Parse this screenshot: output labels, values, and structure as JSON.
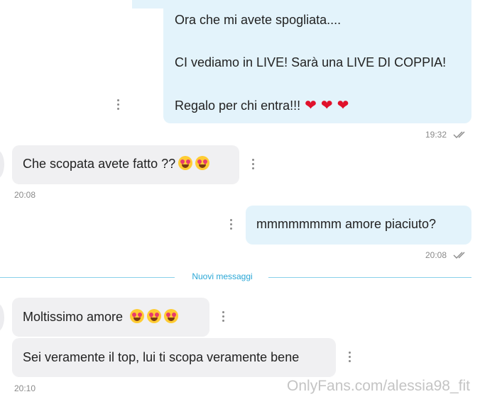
{
  "messages": [
    {
      "lines": [
        "Ora che mi avete spogliata....",
        "CI vediamo in LIVE! Sarà una LIVE DI COPPIA!",
        "Regalo per chi entra!!!"
      ],
      "emojis": [
        "red-heart",
        "red-heart",
        "red-heart"
      ],
      "time": "19:32"
    },
    {
      "text": "Che scopata avete fatto ??",
      "emojis": [
        "heart-eyes",
        "heart-eyes"
      ],
      "time": "20:08"
    },
    {
      "text": "mmmmmmmm amore piaciuto?",
      "time": "20:08"
    },
    {
      "text": "Moltissimo amore",
      "emojis": [
        "heart-eyes",
        "heart-eyes",
        "heart-eyes"
      ]
    },
    {
      "text": "Sei veramente il top, lui ti scopa veramente bene",
      "time": "20:10"
    }
  ],
  "divider_label": "Nuovi messaggi",
  "watermark": "OnlyFans.com/alessia98_fit",
  "colors": {
    "outgoing": "#e3f3fb",
    "incoming": "#f0f0f2",
    "accent": "#2aa7d6",
    "heart": "#e0112b"
  }
}
